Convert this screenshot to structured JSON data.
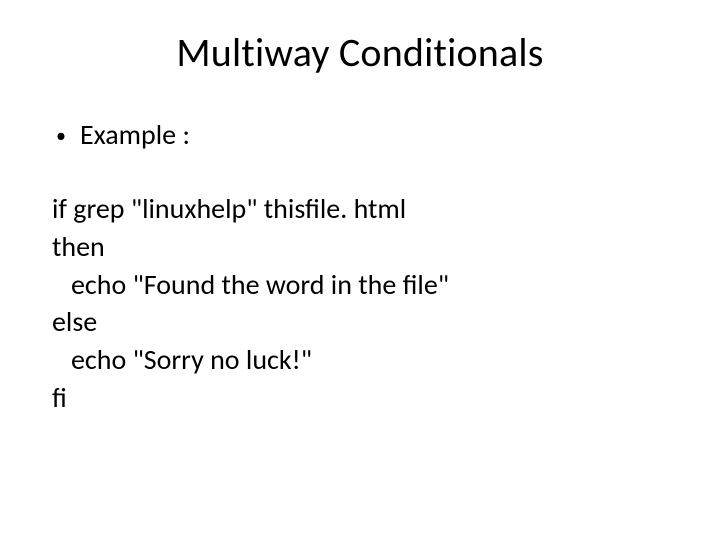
{
  "slide": {
    "title": "Multiway Conditionals",
    "bullet_marker": "•",
    "bullet_label": "Example :",
    "code": "if grep \"linuxhelp\" thisfile. html\nthen\n   echo \"Found the word in the file\"\nelse\n   echo \"Sorry no luck!\"\nfi"
  }
}
